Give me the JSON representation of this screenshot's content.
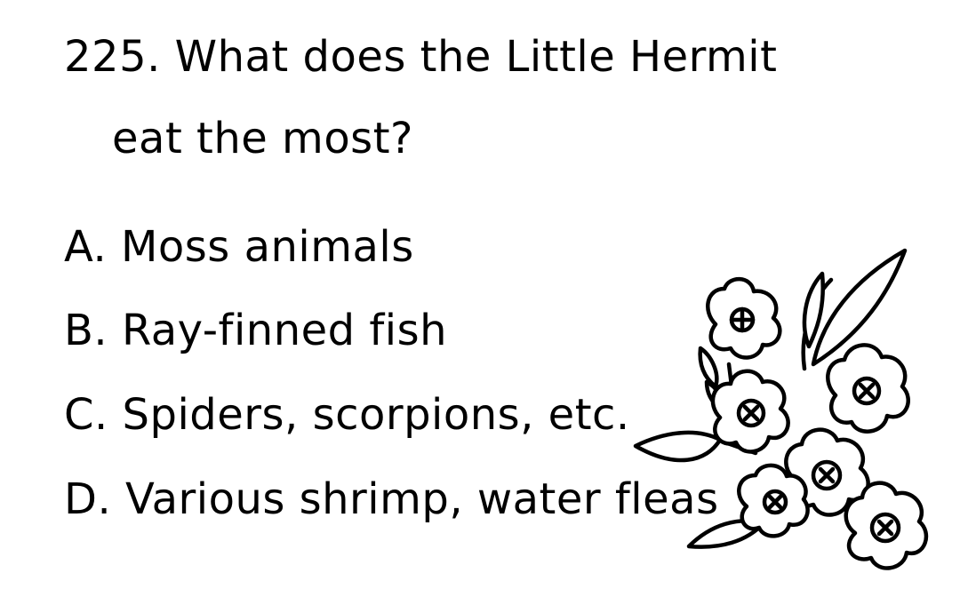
{
  "question": {
    "line1": "225. What does the Little Hermit",
    "line2": "eat the most?"
  },
  "options": [
    {
      "text": "A. Moss animals"
    },
    {
      "text": "B. Ray-finned fish"
    },
    {
      "text": "C. Spiders, scorpions, etc."
    },
    {
      "text": "D. Various shrimp, water fleas"
    }
  ],
  "decoration": {
    "icon": "flower-bouquet-line-art",
    "stroke_color": "#000000",
    "fill_color": "#ffffff"
  }
}
